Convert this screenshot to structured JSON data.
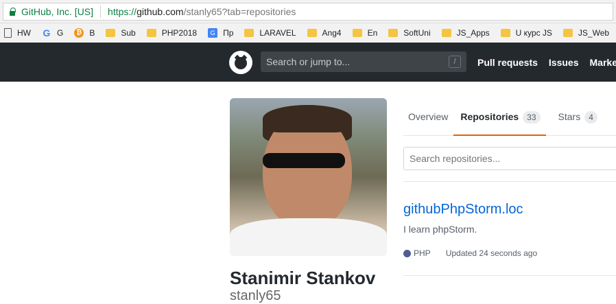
{
  "browser": {
    "site_identity": "GitHub, Inc. [US]",
    "url_scheme": "https://",
    "url_host": "github.com",
    "url_path": "/stanly65?tab=repositories"
  },
  "bookmarks": [
    {
      "label": "HW",
      "icon": "page-icon"
    },
    {
      "label": "G",
      "icon": "google-icon"
    },
    {
      "label": "B",
      "icon": "bitcoin-icon"
    },
    {
      "label": "Sub",
      "icon": "folder-icon"
    },
    {
      "label": "PHP2018",
      "icon": "folder-icon"
    },
    {
      "label": "Пр",
      "icon": "translate-icon"
    },
    {
      "label": "LARAVEL",
      "icon": "folder-icon"
    },
    {
      "label": "Ang4",
      "icon": "folder-icon"
    },
    {
      "label": "En",
      "icon": "folder-icon"
    },
    {
      "label": "SoftUni",
      "icon": "folder-icon"
    },
    {
      "label": "JS_Apps",
      "icon": "folder-icon"
    },
    {
      "label": "U курс JS",
      "icon": "folder-icon"
    },
    {
      "label": "JS_Web",
      "icon": "folder-icon"
    }
  ],
  "header": {
    "search_placeholder": "Search or jump to...",
    "search_shortcut": "/",
    "nav": [
      "Pull requests",
      "Issues",
      "Marketp"
    ]
  },
  "profile": {
    "name": "Stanimir Stankov",
    "username": "stanly65"
  },
  "tabs": [
    {
      "label": "Overview",
      "count": null,
      "active": false
    },
    {
      "label": "Repositories",
      "count": "33",
      "active": true
    },
    {
      "label": "Stars",
      "count": "4",
      "active": false
    }
  ],
  "repo_search": {
    "placeholder": "Search repositories..."
  },
  "repos": [
    {
      "name": "githubPhpStorm.loc",
      "description": "I learn phpStorm.",
      "language": "PHP",
      "language_color": "#4F5D95",
      "updated": "Updated 24 seconds ago"
    }
  ]
}
